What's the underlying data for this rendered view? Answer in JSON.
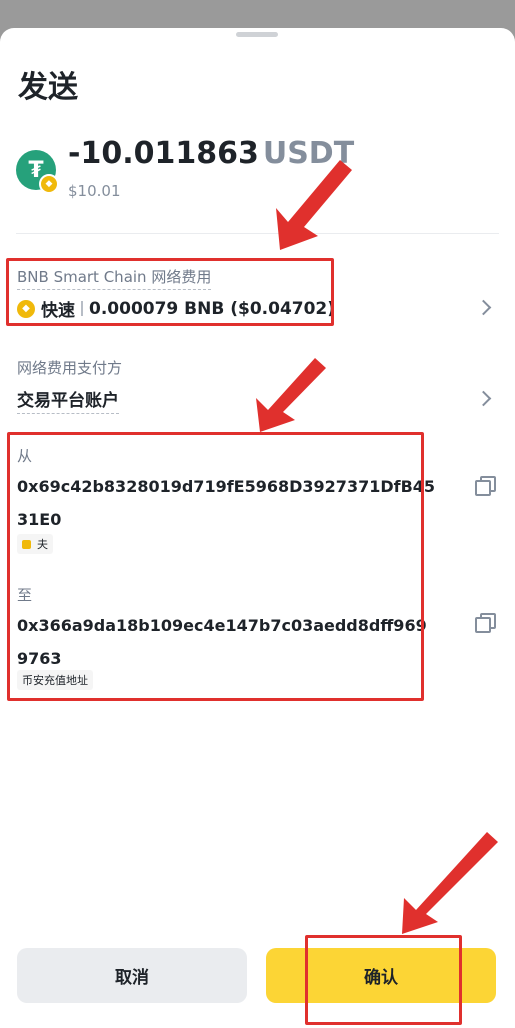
{
  "page": {
    "title": "发送"
  },
  "token": {
    "icon_glyph": "₮",
    "amount": "-10.011863",
    "unit": "USDT",
    "fiat": "$10.01"
  },
  "network_fee": {
    "label": "BNB Smart Chain 网络费用",
    "speed": "快速",
    "amount": "0.000079 BNB ($0.04702)"
  },
  "fee_payer": {
    "label": "网络费用支付方",
    "value": "交易平台账户"
  },
  "from": {
    "label": "从",
    "address": "0x69c42b8328019d719fE5968D3927371DfB4531E0",
    "tag": "夫"
  },
  "to": {
    "label": "至",
    "address": "0x366a9da18b109ec4e147b7c03aedd8dff9699763",
    "tag": "币安充值地址"
  },
  "actions": {
    "cancel": "取消",
    "confirm": "确认"
  },
  "colors": {
    "accent": "#fcd535",
    "annotation": "#e0302d",
    "usdt": "#26a17b",
    "bnb": "#f0b90b"
  }
}
